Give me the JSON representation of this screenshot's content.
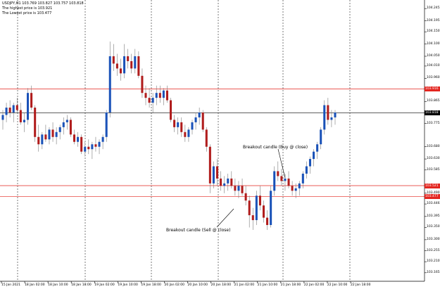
{
  "header": {
    "quote": "USDJPY,H1  103.769 103.827 103.757 103.818",
    "high_line": "The highest price is 103.921",
    "low_line": "The Lowest price is 103.477"
  },
  "price_levels": [
    {
      "label": "104.245",
      "value": 104.245
    },
    {
      "label": "104.195",
      "value": 104.195
    },
    {
      "label": "104.150",
      "value": 104.15
    },
    {
      "label": "104.100",
      "value": 104.1
    },
    {
      "label": "104.050",
      "value": 104.05
    },
    {
      "label": "104.010",
      "value": 104.01
    },
    {
      "label": "103.960",
      "value": 103.96
    },
    {
      "label": "103.865",
      "value": 103.865
    },
    {
      "label": "103.775",
      "value": 103.775
    },
    {
      "label": "103.680",
      "value": 103.68
    },
    {
      "label": "103.630",
      "value": 103.63
    },
    {
      "label": "103.585",
      "value": 103.585
    },
    {
      "label": "103.490",
      "value": 103.49
    },
    {
      "label": "103.446",
      "value": 103.446
    },
    {
      "label": "103.395",
      "value": 103.395
    },
    {
      "label": "103.350",
      "value": 103.35
    },
    {
      "label": "103.300",
      "value": 103.3
    },
    {
      "label": "103.255",
      "value": 103.255
    },
    {
      "label": "103.210",
      "value": 103.21
    },
    {
      "label": "103.165",
      "value": 103.165
    }
  ],
  "markers": [
    {
      "label": "103.916",
      "value": 103.916,
      "color": "#e3251f"
    },
    {
      "label": "103.818",
      "value": 103.818,
      "color": "#000000"
    },
    {
      "label": "103.521",
      "value": 103.521,
      "color": "#e3251f"
    },
    {
      "label": "103.477",
      "value": 103.477,
      "color": "#e3251f"
    }
  ],
  "time_labels": [
    "15 Jan 2021",
    "18 Jan 02:00",
    "18 Jan 10:00",
    "18 Jan 18:00",
    "19 Jan 02:00",
    "19 Jan 10:00",
    "19 Jan 18:00",
    "20 Jan 02:00",
    "20 Jan 10:00",
    "20 Jan 18:00",
    "21 Jan 02:00",
    "21 Jan 10:00",
    "21 Jan 18:00",
    "22 Jan 02:00",
    "22 Jan 10:00",
    "22 Jan 18:00"
  ],
  "annotations": {
    "buy": "Breakout candle (Buy @ close)",
    "sell": "Breakout candle (Sell @ close)"
  },
  "colors": {
    "bull": "#1a52b8",
    "bear": "#b01c1c",
    "wick": "#7a7a7a",
    "level": "#e3251f",
    "current": "#000000",
    "grid": "#222222"
  },
  "chart_data": {
    "type": "candlestick",
    "symbol": "USDJPY",
    "timeframe": "H1",
    "ylim": [
      103.13,
      104.28
    ],
    "ohlc": [
      [
        103.79,
        103.83,
        103.75,
        103.81
      ],
      [
        103.81,
        103.86,
        103.78,
        103.84
      ],
      [
        103.84,
        103.87,
        103.8,
        103.82
      ],
      [
        103.82,
        103.86,
        103.78,
        103.85
      ],
      [
        103.85,
        103.88,
        103.82,
        103.83
      ],
      [
        103.83,
        103.86,
        103.77,
        103.78
      ],
      [
        103.78,
        103.82,
        103.74,
        103.79
      ],
      [
        103.79,
        103.92,
        103.77,
        103.9
      ],
      [
        103.9,
        103.93,
        103.83,
        103.84
      ],
      [
        103.84,
        103.85,
        103.7,
        103.72
      ],
      [
        103.72,
        103.77,
        103.66,
        103.69
      ],
      [
        103.69,
        103.74,
        103.67,
        103.73
      ],
      [
        103.73,
        103.77,
        103.7,
        103.71
      ],
      [
        103.71,
        103.76,
        103.69,
        103.75
      ],
      [
        103.75,
        103.78,
        103.7,
        103.72
      ],
      [
        103.72,
        103.76,
        103.69,
        103.74
      ],
      [
        103.74,
        103.77,
        103.71,
        103.76
      ],
      [
        103.76,
        103.8,
        103.73,
        103.78
      ],
      [
        103.78,
        103.81,
        103.75,
        103.79
      ],
      [
        103.79,
        103.8,
        103.72,
        103.73
      ],
      [
        103.73,
        103.75,
        103.69,
        103.7
      ],
      [
        103.7,
        103.74,
        103.68,
        103.72
      ],
      [
        103.72,
        103.73,
        103.65,
        103.66
      ],
      [
        103.66,
        103.7,
        103.64,
        103.68
      ],
      [
        103.68,
        103.71,
        103.65,
        103.67
      ],
      [
        103.67,
        103.7,
        103.63,
        103.69
      ],
      [
        103.69,
        103.72,
        103.66,
        103.68
      ],
      [
        103.68,
        103.71,
        103.65,
        103.7
      ],
      [
        103.7,
        103.73,
        103.67,
        103.72
      ],
      [
        103.72,
        103.83,
        103.7,
        103.82
      ],
      [
        103.82,
        104.11,
        103.8,
        104.05
      ],
      [
        104.05,
        104.1,
        103.99,
        104.02
      ],
      [
        104.02,
        104.06,
        103.97,
        104.0
      ],
      [
        104.0,
        104.04,
        103.95,
        103.98
      ],
      [
        103.98,
        104.1,
        103.96,
        104.05
      ],
      [
        104.05,
        104.08,
        104.0,
        104.03
      ],
      [
        104.03,
        104.06,
        103.98,
        104.0
      ],
      [
        104.0,
        104.08,
        103.98,
        104.05
      ],
      [
        104.05,
        104.07,
        103.96,
        103.97
      ],
      [
        103.97,
        104.0,
        103.88,
        103.9
      ],
      [
        103.9,
        103.93,
        103.85,
        103.88
      ],
      [
        103.88,
        103.92,
        103.84,
        103.86
      ],
      [
        103.86,
        103.9,
        103.82,
        103.88
      ],
      [
        103.88,
        103.93,
        103.85,
        103.9
      ],
      [
        103.9,
        103.93,
        103.86,
        103.88
      ],
      [
        103.88,
        103.92,
        103.85,
        103.91
      ],
      [
        103.91,
        103.93,
        103.86,
        103.87
      ],
      [
        103.87,
        103.88,
        103.78,
        103.79
      ],
      [
        103.79,
        103.81,
        103.74,
        103.76
      ],
      [
        103.76,
        103.8,
        103.73,
        103.78
      ],
      [
        103.78,
        103.8,
        103.72,
        103.74
      ],
      [
        103.74,
        103.77,
        103.7,
        103.72
      ],
      [
        103.72,
        103.76,
        103.7,
        103.75
      ],
      [
        103.75,
        103.79,
        103.73,
        103.78
      ],
      [
        103.78,
        103.82,
        103.75,
        103.8
      ],
      [
        103.8,
        103.84,
        103.77,
        103.82
      ],
      [
        103.82,
        103.83,
        103.74,
        103.75
      ],
      [
        103.75,
        103.76,
        103.66,
        103.68
      ],
      [
        103.68,
        103.69,
        103.49,
        103.53
      ],
      [
        103.53,
        103.62,
        103.51,
        103.6
      ],
      [
        103.6,
        103.63,
        103.52,
        103.55
      ],
      [
        103.55,
        103.58,
        103.5,
        103.52
      ],
      [
        103.52,
        103.56,
        103.49,
        103.53
      ],
      [
        103.53,
        103.57,
        103.5,
        103.55
      ],
      [
        103.55,
        103.58,
        103.51,
        103.52
      ],
      [
        103.52,
        103.55,
        103.48,
        103.5
      ],
      [
        103.5,
        103.54,
        103.47,
        103.52
      ],
      [
        103.52,
        103.55,
        103.48,
        103.49
      ],
      [
        103.49,
        103.52,
        103.44,
        103.46
      ],
      [
        103.46,
        103.48,
        103.35,
        103.4
      ],
      [
        103.4,
        103.43,
        103.34,
        103.38
      ],
      [
        103.38,
        103.5,
        103.36,
        103.48
      ],
      [
        103.48,
        103.52,
        103.42,
        103.44
      ],
      [
        103.44,
        103.46,
        103.37,
        103.39
      ],
      [
        103.39,
        103.42,
        103.34,
        103.36
      ],
      [
        103.36,
        103.52,
        103.35,
        103.5
      ],
      [
        103.5,
        103.6,
        103.48,
        103.58
      ],
      [
        103.58,
        103.62,
        103.54,
        103.56
      ],
      [
        103.56,
        103.59,
        103.52,
        103.54
      ],
      [
        103.54,
        103.57,
        103.5,
        103.55
      ],
      [
        103.55,
        103.58,
        103.51,
        103.52
      ],
      [
        103.52,
        103.54,
        103.48,
        103.5
      ],
      [
        103.5,
        103.53,
        103.47,
        103.51
      ],
      [
        103.51,
        103.54,
        103.48,
        103.53
      ],
      [
        103.53,
        103.58,
        103.51,
        103.57
      ],
      [
        103.57,
        103.62,
        103.55,
        103.6
      ],
      [
        103.6,
        103.64,
        103.57,
        103.63
      ],
      [
        103.63,
        103.67,
        103.6,
        103.66
      ],
      [
        103.66,
        103.7,
        103.63,
        103.69
      ],
      [
        103.69,
        103.76,
        103.67,
        103.75
      ],
      [
        103.75,
        103.87,
        103.73,
        103.85
      ],
      [
        103.85,
        103.88,
        103.77,
        103.79
      ],
      [
        103.79,
        103.83,
        103.76,
        103.8
      ],
      [
        103.8,
        103.83,
        103.77,
        103.82
      ]
    ]
  }
}
